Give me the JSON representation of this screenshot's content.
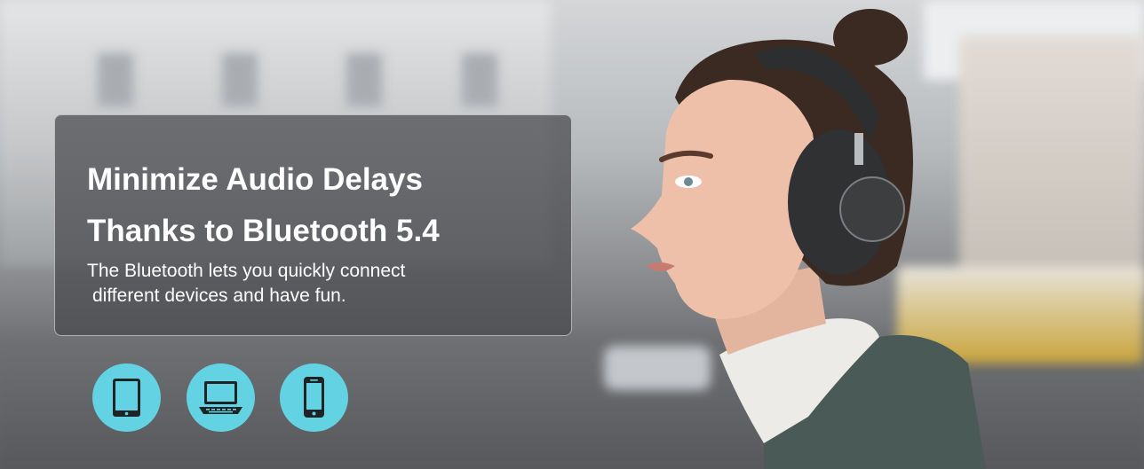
{
  "banner": {
    "headline_line1": "Minimize Audio Delays",
    "headline_line2": "Thanks to Bluetooth 5.4",
    "subtext_line1": "The Bluetooth lets you quickly connect",
    "subtext_line2": "different devices and have fun."
  },
  "device_icons": [
    "tablet-icon",
    "laptop-icon",
    "smartphone-icon"
  ],
  "colors": {
    "icon_background": "#63d3e4",
    "panel_background": "#46484c",
    "headline_text": "#ffffff"
  }
}
